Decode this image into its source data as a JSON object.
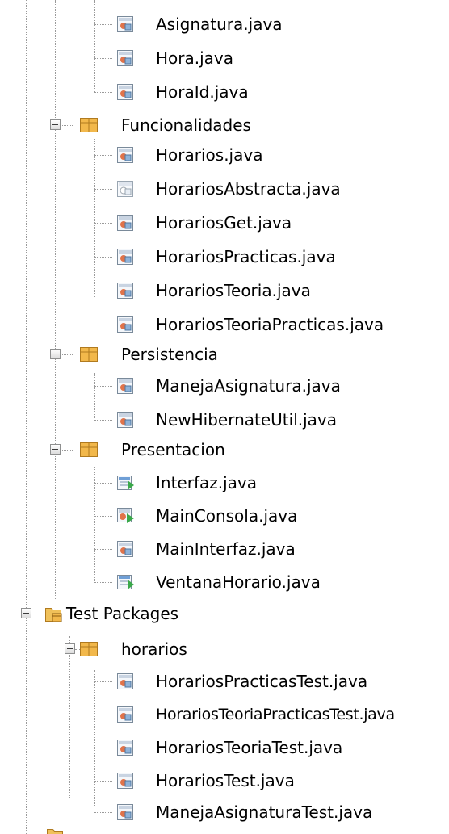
{
  "tree": {
    "nodes": [
      {
        "id": "asignatura",
        "type": "file",
        "icon": "java-class-icon",
        "label": "Asignatura.java"
      },
      {
        "id": "hora",
        "type": "file",
        "icon": "java-class-icon",
        "label": "Hora.java"
      },
      {
        "id": "horaid",
        "type": "file",
        "icon": "java-class-icon",
        "label": "HoraId.java"
      },
      {
        "id": "funcionalidades",
        "type": "package",
        "icon": "package-icon",
        "label": "Funcionalidades",
        "expanded": true
      },
      {
        "id": "horarios-java",
        "type": "file",
        "icon": "java-class-icon",
        "label": "Horarios.java"
      },
      {
        "id": "horarios-abstracta",
        "type": "file",
        "icon": "java-abstract-class-icon",
        "label": "HorariosAbstracta.java"
      },
      {
        "id": "horarios-get",
        "type": "file",
        "icon": "java-class-icon",
        "label": "HorariosGet.java"
      },
      {
        "id": "horarios-practicas",
        "type": "file",
        "icon": "java-class-icon",
        "label": "HorariosPracticas.java"
      },
      {
        "id": "horarios-teoria",
        "type": "file",
        "icon": "java-class-icon",
        "label": "HorariosTeoria.java"
      },
      {
        "id": "horarios-teoria-practicas",
        "type": "file",
        "icon": "java-class-icon",
        "label": "HorariosTeoriaPracticas.java"
      },
      {
        "id": "persistencia",
        "type": "package",
        "icon": "package-icon",
        "label": "Persistencia",
        "expanded": true
      },
      {
        "id": "maneja-asignatura",
        "type": "file",
        "icon": "java-class-icon",
        "label": "ManejaAsignatura.java"
      },
      {
        "id": "new-hibernate-util",
        "type": "file",
        "icon": "java-class-icon",
        "label": "NewHibernateUtil.java"
      },
      {
        "id": "presentacion",
        "type": "package",
        "icon": "package-icon",
        "label": "Presentacion",
        "expanded": true
      },
      {
        "id": "interfaz",
        "type": "file",
        "icon": "java-form-icon",
        "label": "Interfaz.java"
      },
      {
        "id": "main-consola",
        "type": "file",
        "icon": "java-main-class-icon",
        "label": "MainConsola.java"
      },
      {
        "id": "main-interfaz",
        "type": "file",
        "icon": "java-class-icon",
        "label": "MainInterfaz.java"
      },
      {
        "id": "ventana-horario",
        "type": "file",
        "icon": "java-form-icon",
        "label": "VentanaHorario.java"
      },
      {
        "id": "test-packages",
        "type": "folder",
        "icon": "test-packages-icon",
        "label": "Test Packages",
        "expanded": true
      },
      {
        "id": "horarios-pkg",
        "type": "package",
        "icon": "package-icon",
        "label": "horarios",
        "expanded": true
      },
      {
        "id": "horarios-practicas-test",
        "type": "file",
        "icon": "java-class-icon",
        "label": "HorariosPracticasTest.java"
      },
      {
        "id": "horarios-teoria-practicas-test",
        "type": "file",
        "icon": "java-class-icon",
        "label": "HorariosTeoriaPracticasTest.java"
      },
      {
        "id": "horarios-teoria-test",
        "type": "file",
        "icon": "java-class-icon",
        "label": "HorariosTeoriaTest.java"
      },
      {
        "id": "horarios-test",
        "type": "file",
        "icon": "java-class-icon",
        "label": "HorariosTest.java"
      },
      {
        "id": "maneja-asignatura-test",
        "type": "file",
        "icon": "java-class-icon",
        "label": "ManejaAsignaturaTest.java"
      }
    ]
  },
  "colors": {
    "package_fill": "#f2b84b",
    "package_border": "#b07a1f",
    "class_icon_border": "#7a8a9a",
    "class_icon_accent": "#e0734a",
    "run_arrow": "#3aa84a",
    "tree_line": "#9a9a9a"
  }
}
